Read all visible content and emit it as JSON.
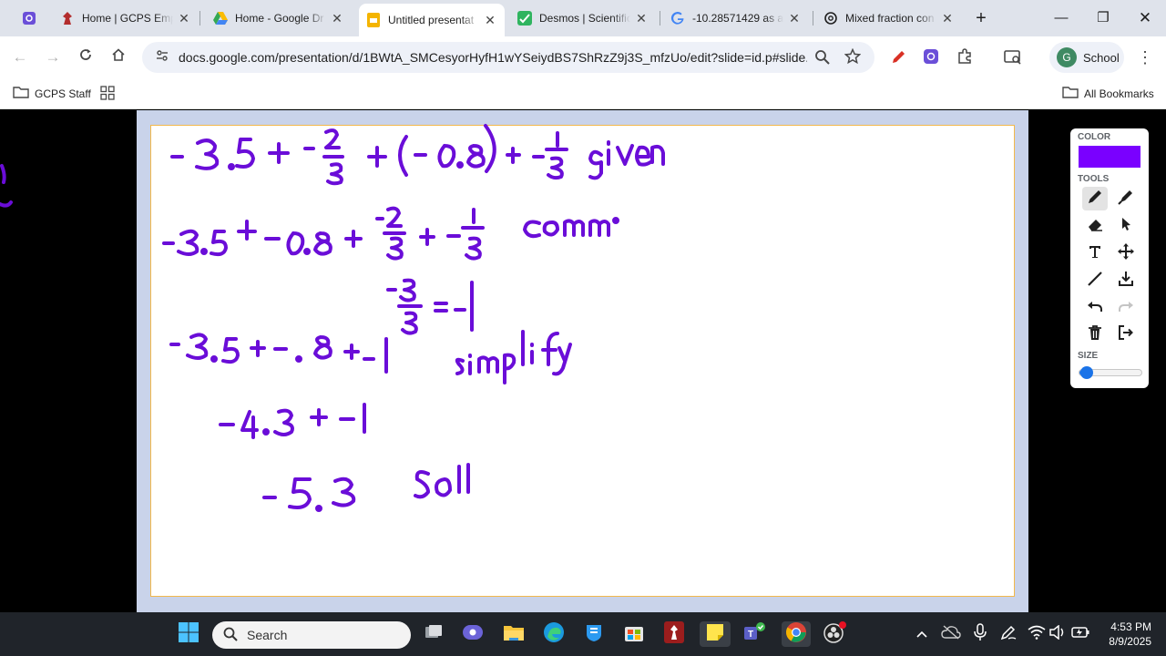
{
  "browser": {
    "tabs": [
      {
        "title": "Home | GCPS Emp",
        "favicon": "gcps-icon"
      },
      {
        "title": "Home - Google Dr",
        "favicon": "google-drive-icon"
      },
      {
        "title": "Untitled presentat",
        "favicon": "google-slides-icon",
        "active": true
      },
      {
        "title": "Desmos | Scientific",
        "favicon": "desmos-icon"
      },
      {
        "title": "-10.28571429 as a",
        "favicon": "google-icon"
      },
      {
        "title": "Mixed fraction con",
        "favicon": "chatgpt-icon"
      }
    ],
    "url": "docs.google.com/presentation/d/1BWtA_SMCesyorHyfH1wYSeiydBS7ShRzZ9j3S_mfzUo/edit?slide=id.p#slide...",
    "profile_label": "School",
    "profile_initial": "G",
    "bookmarks": [
      {
        "label": "GCPS Staff"
      }
    ],
    "all_bookmarks_label": "All Bookmarks"
  },
  "palette": {
    "color_label": "COLOR",
    "tools_label": "TOOLS",
    "size_label": "SIZE",
    "current_color": "#7a00ff",
    "size_level": 0.12
  },
  "taskbar": {
    "search_placeholder": "Search",
    "time": "4:53 PM",
    "date": "8/9/2025"
  },
  "colors": {
    "ink": "#6a0dd8",
    "slide_border": "#f2b84b",
    "accent": "#1a73e8"
  }
}
